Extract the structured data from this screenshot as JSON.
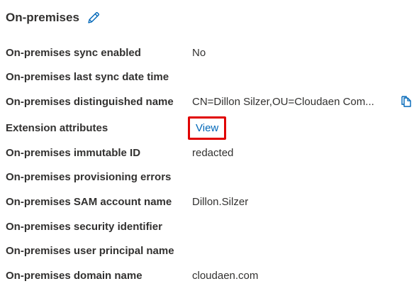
{
  "section": {
    "title": "On-premises",
    "edit_icon": "pencil-icon"
  },
  "fields": [
    {
      "label": "On-premises sync enabled",
      "value": "No"
    },
    {
      "label": "On-premises last sync date time",
      "value": ""
    },
    {
      "label": "On-premises distinguished name",
      "value": "CN=Dillon Silzer,OU=Cloudaen Com...",
      "action_icon": "copy-icon"
    },
    {
      "label": "Extension attributes",
      "value": "View",
      "highlight_color": "#e00000"
    },
    {
      "label": "On-premises immutable ID",
      "value": "redacted"
    },
    {
      "label": "On-premises provisioning errors",
      "value": ""
    },
    {
      "label": "On-premises SAM account name",
      "value": "Dillon.Silzer"
    },
    {
      "label": "On-premises security identifier",
      "value": ""
    },
    {
      "label": "On-premises user principal name",
      "value": ""
    },
    {
      "label": "On-premises domain name",
      "value": "cloudaen.com"
    }
  ],
  "colors": {
    "accent": "#0067b8",
    "text": "#323130",
    "highlight": "#e00000"
  }
}
